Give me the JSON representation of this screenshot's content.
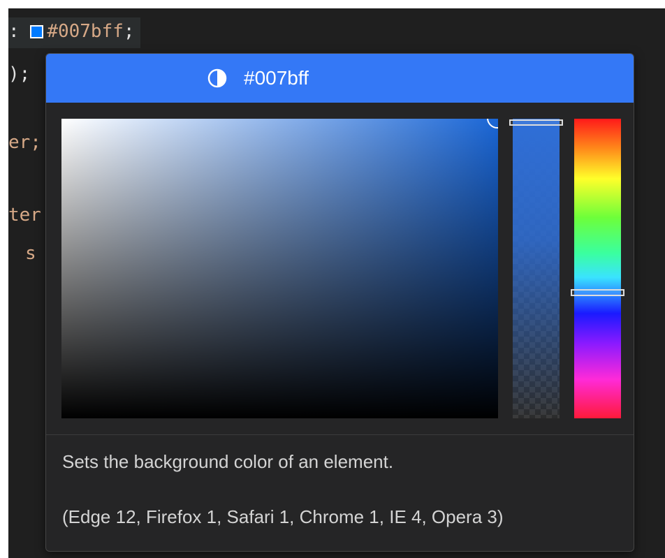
{
  "editor": {
    "line1": {
      "prefix": ":",
      "value": "#007bff",
      "suffix": ";"
    },
    "line2": ");",
    "line3": "er;",
    "line4": "ter",
    "line5": "s"
  },
  "picker": {
    "header_hex": "#007bff",
    "header_icon": "contrast-icon",
    "accent_color": "#3478f6",
    "current_color": "#007bff",
    "description": "Sets the background color of an element.",
    "compatibility": "(Edge 12, Firefox 1, Safari 1, Chrome 1, IE 4, Opera 3)"
  }
}
